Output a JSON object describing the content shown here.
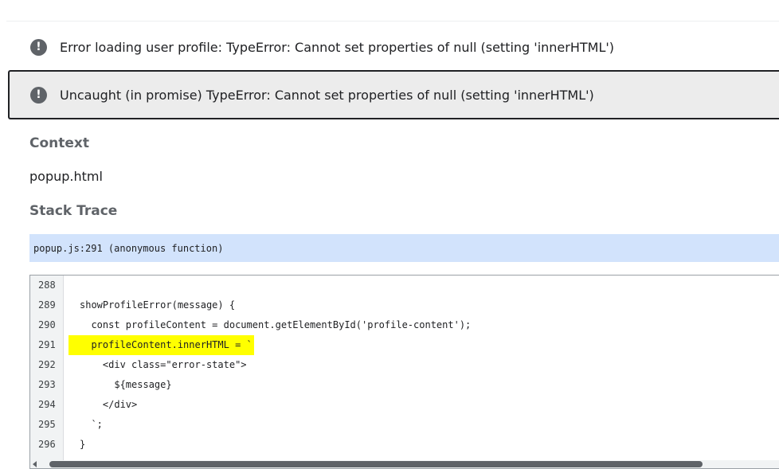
{
  "errors": [
    {
      "icon": "error-icon",
      "glyph": "!",
      "message": "Error loading user profile: TypeError: Cannot set properties of null (setting 'innerHTML')"
    },
    {
      "icon": "error-icon",
      "glyph": "!",
      "message": "Uncaught (in promise) TypeError: Cannot set properties of null (setting 'innerHTML')"
    }
  ],
  "context": {
    "heading": "Context",
    "value": "popup.html"
  },
  "stack_trace": {
    "heading": "Stack Trace",
    "frames": [
      "popup.js:291 (anonymous function)"
    ]
  },
  "code": {
    "highlighted_line": 291,
    "lines": [
      {
        "num": "288",
        "text": ""
      },
      {
        "num": "289",
        "text": "showProfileError(message) {"
      },
      {
        "num": "290",
        "text": "  const profileContent = document.getElementById('profile-content');"
      },
      {
        "num": "291",
        "text": "  profileContent.innerHTML = `"
      },
      {
        "num": "292",
        "text": "    <div class=\"error-state\">"
      },
      {
        "num": "293",
        "text": "      ${message}"
      },
      {
        "num": "294",
        "text": "    </div>"
      },
      {
        "num": "295",
        "text": "  `;"
      },
      {
        "num": "296",
        "text": "}"
      }
    ]
  },
  "colors": {
    "frame_highlight": "#d2e3fc",
    "line_highlight": "#ffff00",
    "error_icon": "#5f6368"
  }
}
